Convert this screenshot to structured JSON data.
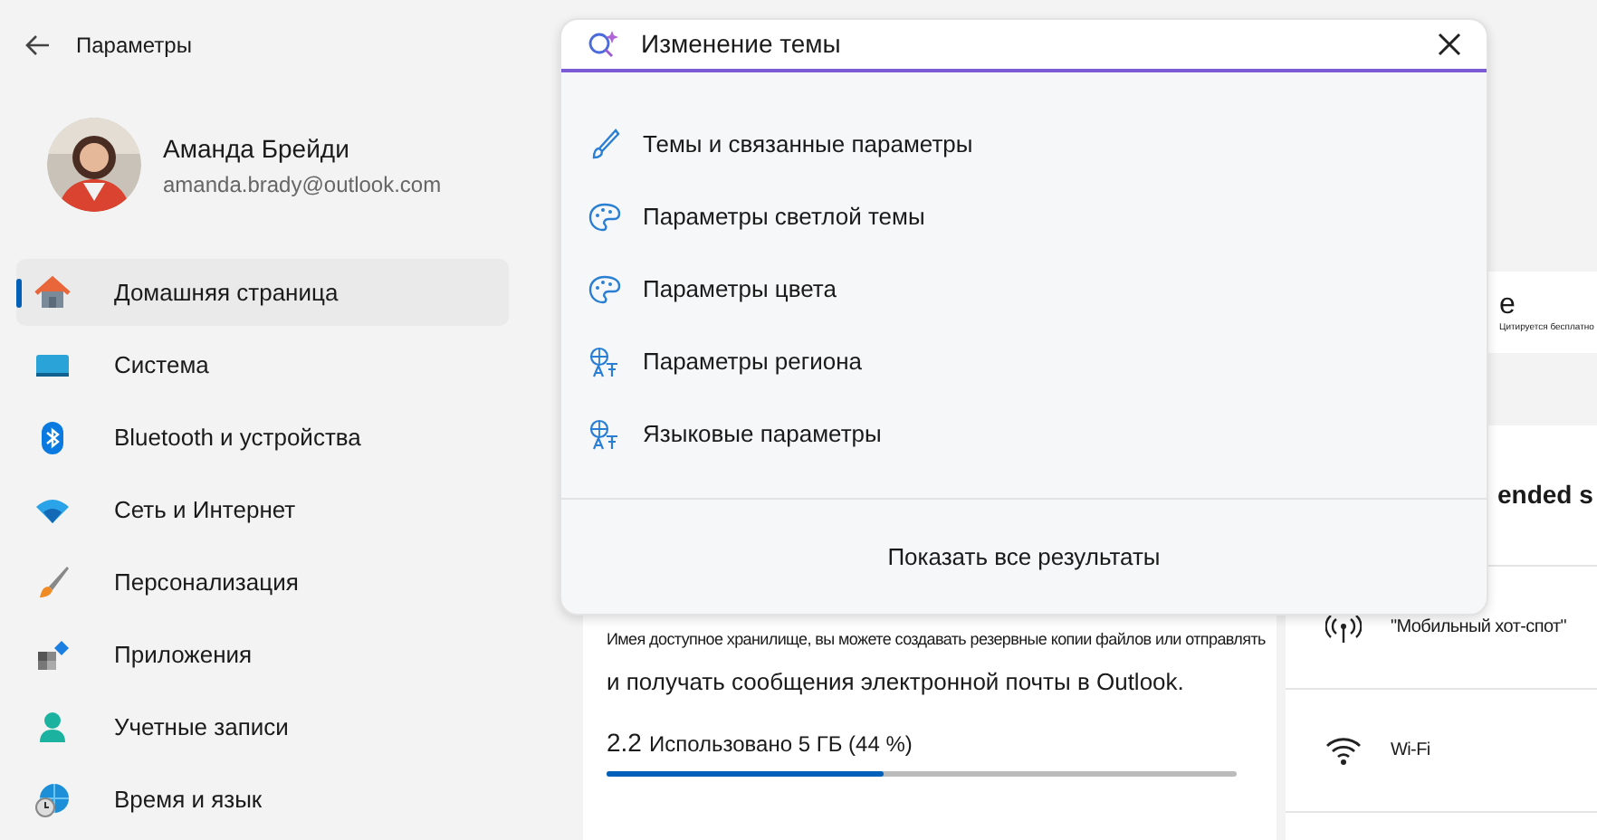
{
  "window": {
    "title": "Параметры"
  },
  "user": {
    "name": "Аманда Брейди",
    "email": "amanda.brady@outlook.com"
  },
  "sidebar": {
    "items": [
      {
        "label": "Домашняя страница",
        "kind": "home",
        "selected": true
      },
      {
        "label": "Система",
        "kind": "system",
        "selected": false
      },
      {
        "label": "Bluetooth и устройства",
        "kind": "bluetooth",
        "selected": false
      },
      {
        "label": "Сеть и Интернет",
        "kind": "network",
        "selected": false
      },
      {
        "label": "Персонализация",
        "kind": "personalization",
        "selected": false
      },
      {
        "label": "Приложения",
        "kind": "apps",
        "selected": false
      },
      {
        "label": "Учетные записи",
        "kind": "accounts",
        "selected": false
      },
      {
        "label": "Время и язык",
        "kind": "time",
        "selected": false
      }
    ]
  },
  "top_card": {
    "title": "e",
    "subtitle": "Цитируется бесплатно"
  },
  "storage_card": {
    "description_line_1": "Имея доступное хранилище, вы можете создавать резервные копии файлов или отправлять",
    "description_line_2": "и получать сообщения электронной почты в Outlook.",
    "amount": "2.2",
    "usage": "Использовано 5 ГБ (44 %)",
    "level": 0.44
  },
  "recommended": {
    "title": "ended s",
    "items": [
      {
        "label": "\"Мобильный хот-спот\"",
        "kind": "hotspot"
      },
      {
        "label": "Wi-Fi",
        "kind": "wifi"
      }
    ]
  },
  "search": {
    "value": "Изменение темы",
    "results": [
      {
        "label": "Темы и связанные параметры",
        "kind": "themes"
      },
      {
        "label": "Параметры светлой темы",
        "kind": "theme"
      },
      {
        "label": "Параметры цвета",
        "kind": "theme"
      },
      {
        "label": "Параметры региона",
        "kind": "language"
      },
      {
        "label": "Языковые параметры",
        "kind": "language"
      }
    ],
    "show_all": "Показать все результаты"
  }
}
